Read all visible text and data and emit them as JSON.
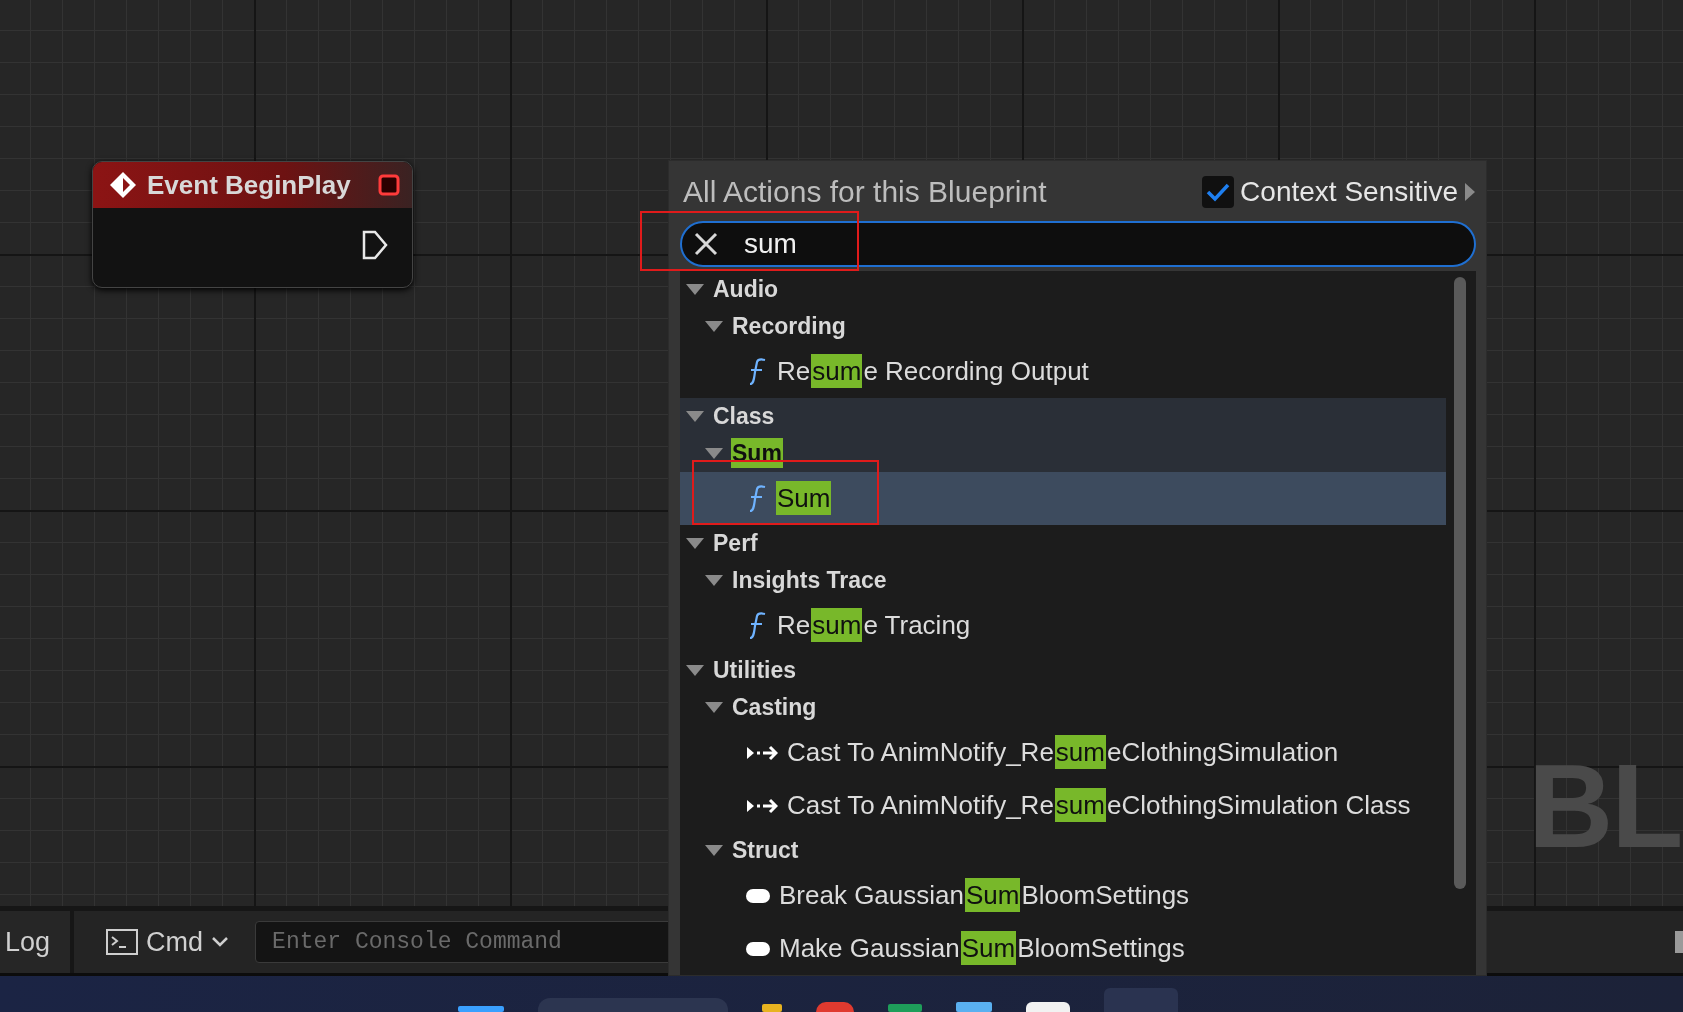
{
  "graph": {
    "watermark": "BL"
  },
  "node": {
    "title": "Event BeginPlay"
  },
  "action_menu": {
    "title": "All Actions for this Blueprint",
    "context_sensitive": {
      "label": "Context Sensitive",
      "checked": true
    },
    "search": {
      "value": "sum"
    },
    "tree": [
      {
        "kind": "category",
        "parts": [
          {
            "text": "Audio",
            "match": false
          }
        ],
        "expanded": true,
        "children": [
          {
            "kind": "category",
            "parts": [
              {
                "text": "Recording",
                "match": false
              }
            ],
            "expanded": true,
            "children": [
              {
                "kind": "function",
                "selected": false,
                "parts": [
                  {
                    "text": "Re",
                    "match": false
                  },
                  {
                    "text": "sum",
                    "match": true
                  },
                  {
                    "text": "e Recording Output",
                    "match": false
                  }
                ]
              }
            ]
          }
        ]
      },
      {
        "kind": "category",
        "parts": [
          {
            "text": "Class",
            "match": false
          }
        ],
        "expanded": true,
        "children": [
          {
            "kind": "category",
            "parts": [
              {
                "text": "Sum",
                "match": true
              }
            ],
            "expanded": true,
            "children": [
              {
                "kind": "function",
                "selected": true,
                "parts": [
                  {
                    "text": "Sum",
                    "match": true
                  }
                ]
              }
            ]
          }
        ]
      },
      {
        "kind": "category",
        "parts": [
          {
            "text": "Perf",
            "match": false
          }
        ],
        "expanded": true,
        "children": [
          {
            "kind": "category",
            "parts": [
              {
                "text": "Insights Trace",
                "match": false
              }
            ],
            "expanded": true,
            "children": [
              {
                "kind": "function",
                "selected": false,
                "parts": [
                  {
                    "text": "Re",
                    "match": false
                  },
                  {
                    "text": "sum",
                    "match": true
                  },
                  {
                    "text": "e Tracing",
                    "match": false
                  }
                ]
              }
            ]
          }
        ]
      },
      {
        "kind": "category",
        "parts": [
          {
            "text": "Utilities",
            "match": false
          }
        ],
        "expanded": true,
        "children": [
          {
            "kind": "category",
            "parts": [
              {
                "text": "Casting",
                "match": false
              }
            ],
            "expanded": true,
            "children": [
              {
                "kind": "cast",
                "selected": false,
                "parts": [
                  {
                    "text": "Cast To AnimNotify_Re",
                    "match": false
                  },
                  {
                    "text": "sum",
                    "match": true
                  },
                  {
                    "text": "eClothingSimulation",
                    "match": false
                  }
                ]
              },
              {
                "kind": "cast",
                "selected": false,
                "parts": [
                  {
                    "text": "Cast To AnimNotify_Re",
                    "match": false
                  },
                  {
                    "text": "sum",
                    "match": true
                  },
                  {
                    "text": "eClothingSimulation Class",
                    "match": false
                  }
                ]
              }
            ]
          },
          {
            "kind": "category",
            "parts": [
              {
                "text": "Struct",
                "match": false
              }
            ],
            "expanded": true,
            "children": [
              {
                "kind": "struct",
                "selected": false,
                "parts": [
                  {
                    "text": "Break Gaussian",
                    "match": false
                  },
                  {
                    "text": "Sum",
                    "match": true
                  },
                  {
                    "text": "BloomSettings",
                    "match": false
                  }
                ]
              },
              {
                "kind": "struct",
                "selected": false,
                "parts": [
                  {
                    "text": "Make Gaussian",
                    "match": false
                  },
                  {
                    "text": "Sum",
                    "match": true
                  },
                  {
                    "text": "BloomSettings",
                    "match": false
                  }
                ]
              }
            ]
          }
        ]
      }
    ]
  },
  "console": {
    "log_tab": "Log",
    "cmd_label": "Cmd",
    "placeholder": "Enter Console Command"
  }
}
